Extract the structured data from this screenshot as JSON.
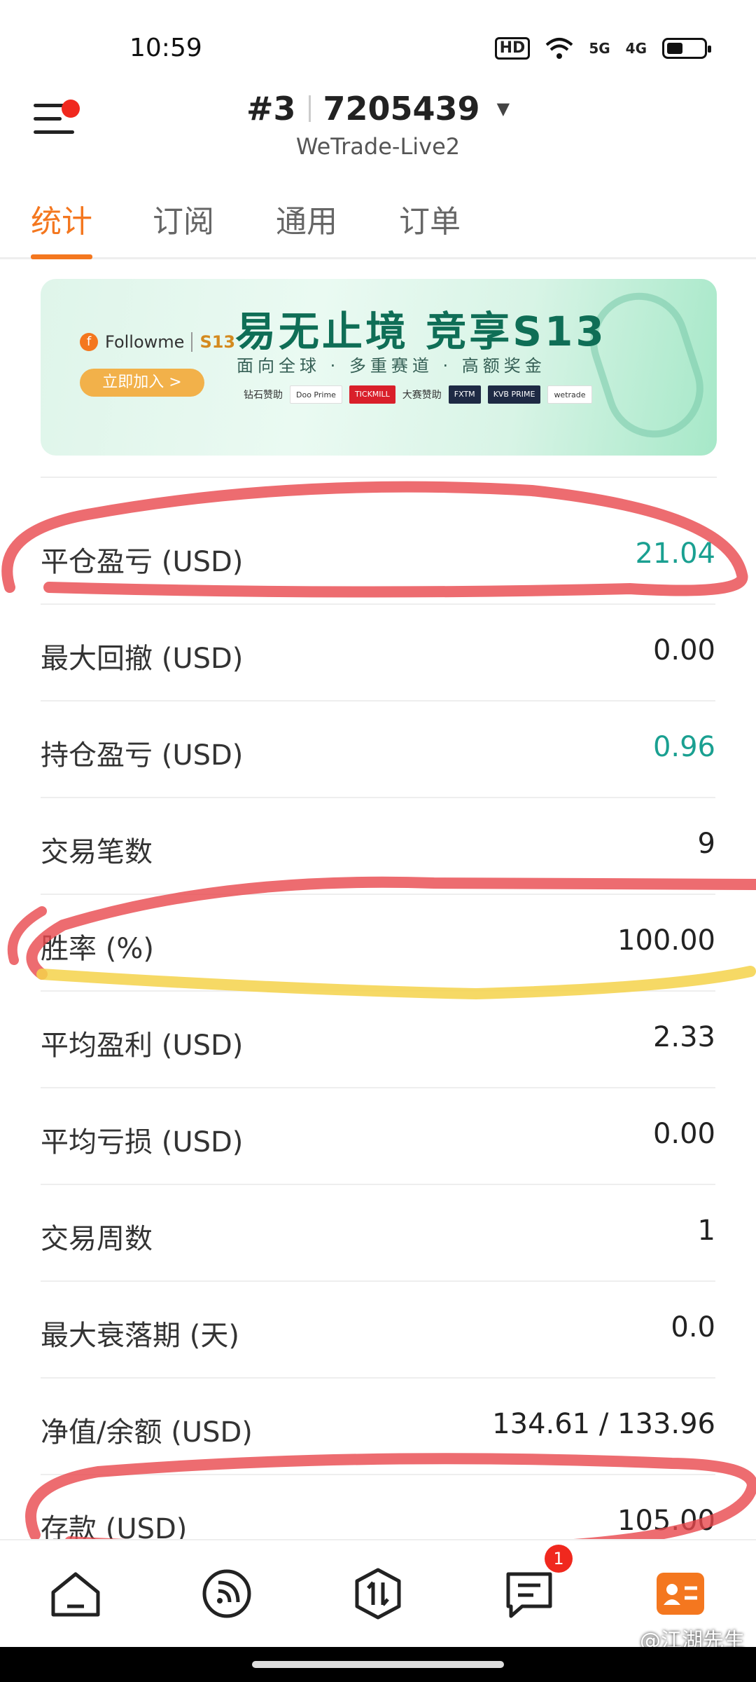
{
  "status": {
    "time": "10:59",
    "hd_icon": "hd-icon",
    "signal_5g": "5G",
    "signal_4g": "4G"
  },
  "header": {
    "account_no": "#3",
    "account_id": "7205439",
    "server": "WeTrade-Live2"
  },
  "tabs": [
    {
      "label": "统计",
      "active": true
    },
    {
      "label": "订阅",
      "active": false
    },
    {
      "label": "通用",
      "active": false
    },
    {
      "label": "订单",
      "active": false
    }
  ],
  "banner": {
    "brand": "Followme",
    "brand_tag": "S13",
    "join_button": "立即加入 >",
    "headline": "易无止境 竞享S13",
    "subline": "面向全球 · 多重赛道 · 高额奖金",
    "sponsor_diamond": "钻石赞助",
    "sponsor_main": "大赛赞助",
    "sponsors": [
      "Doo Prime",
      "TICKMILL",
      "FXTM",
      "KVB PRIME",
      "wetrade"
    ]
  },
  "stats": [
    {
      "label": "平仓盈亏 (USD)",
      "value": "21.04",
      "color": "green"
    },
    {
      "label": "最大回撤 (USD)",
      "value": "0.00",
      "color": "default"
    },
    {
      "label": "持仓盈亏 (USD)",
      "value": "0.96",
      "color": "green"
    },
    {
      "label": "交易笔数",
      "value": "9",
      "color": "default"
    },
    {
      "label": "胜率 (%)",
      "value": "100.00",
      "color": "default"
    },
    {
      "label": "平均盈利 (USD)",
      "value": "2.33",
      "color": "default"
    },
    {
      "label": "平均亏损 (USD)",
      "value": "0.00",
      "color": "default"
    },
    {
      "label": "交易周数",
      "value": "1",
      "color": "default"
    },
    {
      "label": "最大衰落期 (天)",
      "value": "0.0",
      "color": "default"
    },
    {
      "label": "净值/余额 (USD)",
      "value": "134.61 / 133.96",
      "color": "default"
    },
    {
      "label": "存款 (USD)",
      "value": "105.00",
      "color": "default"
    }
  ],
  "nav": {
    "items": [
      "home-icon",
      "feed-icon",
      "trade-icon",
      "message-icon",
      "profile-icon"
    ],
    "message_badge": "1",
    "active": "profile-icon"
  },
  "watermark": "@江湖先生",
  "colors": {
    "accent": "#f4771f",
    "green": "#1aa091",
    "marker_red": "#e8474c",
    "marker_yellow": "#f5d24a"
  }
}
